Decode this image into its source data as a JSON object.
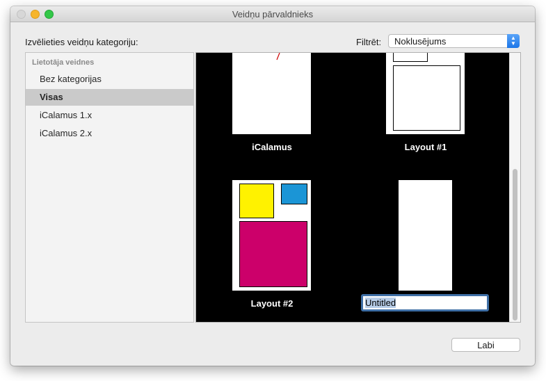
{
  "window": {
    "title": "Veidņu pārvaldnieks"
  },
  "prompt_label": "Izvēlieties veidņu kategoriju:",
  "filter": {
    "label": "Filtrēt:",
    "selected": "Noklusējums"
  },
  "sidebar": {
    "header": "Lietotāja veidnes",
    "items": [
      {
        "label": "Bez kategorijas",
        "selected": false
      },
      {
        "label": "Visas",
        "selected": true
      },
      {
        "label": "iCalamus 1.x",
        "selected": false
      },
      {
        "label": "iCalamus 2.x",
        "selected": false
      }
    ]
  },
  "templates": [
    {
      "name": "iCalamus"
    },
    {
      "name": "Layout #1"
    },
    {
      "name": "Layout #2",
      "colors": {
        "yellow": "#fff200",
        "blue": "#1b95d6",
        "magenta": "#cc006a"
      }
    },
    {
      "name": "Untitled",
      "editing": true
    }
  ],
  "ok_button": "Labi"
}
